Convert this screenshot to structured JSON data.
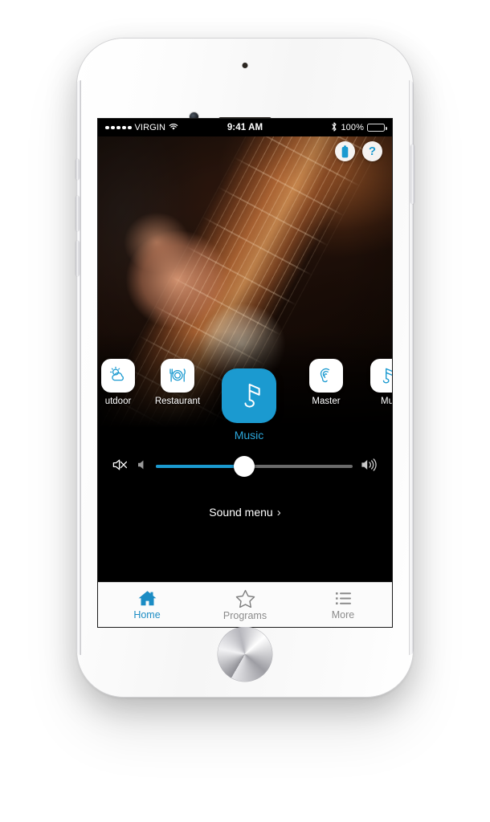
{
  "status_bar": {
    "signal_dots": 5,
    "carrier": "VIRGIN",
    "wifi_icon": "wifi-icon",
    "time": "9:41 AM",
    "bluetooth_icon": "bluetooth-icon",
    "battery_percent": "100%",
    "battery_icon": "battery-full-icon"
  },
  "hero": {
    "image_description": "close-up photo of hands playing an electric bass guitar",
    "actions": [
      {
        "name": "battery-status-button",
        "icon": "battery-icon",
        "label": ""
      },
      {
        "name": "help-button",
        "icon": "question-mark-icon",
        "label": "?"
      }
    ]
  },
  "programs": [
    {
      "label": "utdoor",
      "full_label": "Outdoor",
      "icon": "sun-cloud-icon",
      "selected": false,
      "clipped": true
    },
    {
      "label": "Restaurant",
      "full_label": "Restaurant",
      "icon": "cutlery-plate-icon",
      "selected": false,
      "clipped": false
    },
    {
      "label": "Music",
      "full_label": "Music",
      "icon": "music-note-icon",
      "selected": true,
      "clipped": false
    },
    {
      "label": "Master",
      "full_label": "Master",
      "icon": "ear-icon",
      "selected": false,
      "clipped": false
    },
    {
      "label": "Mu",
      "full_label": "Music",
      "icon": "music-note-icon",
      "selected": false,
      "clipped": true
    }
  ],
  "volume": {
    "mute_icon": "speaker-mute-icon",
    "min_icon": "speaker-low-icon",
    "max_icon": "speaker-high-icon",
    "value_percent": 45,
    "fill_color": "#1b9ad0",
    "track_color": "#6a6a6a"
  },
  "sound_menu": {
    "label": "Sound menu",
    "chevron": "›"
  },
  "tabs": [
    {
      "label": "Home",
      "icon": "home-icon",
      "active": true
    },
    {
      "label": "Programs",
      "icon": "star-icon",
      "active": false
    },
    {
      "label": "More",
      "icon": "list-icon",
      "active": false
    }
  ],
  "theme": {
    "accent": "#1b9ad0",
    "tab_active": "#1b8cc4",
    "tab_inactive": "#8b8b8b",
    "screen_bg": "#000000"
  },
  "device": {
    "model": "white iPhone with home button",
    "home_button": "home-button"
  }
}
